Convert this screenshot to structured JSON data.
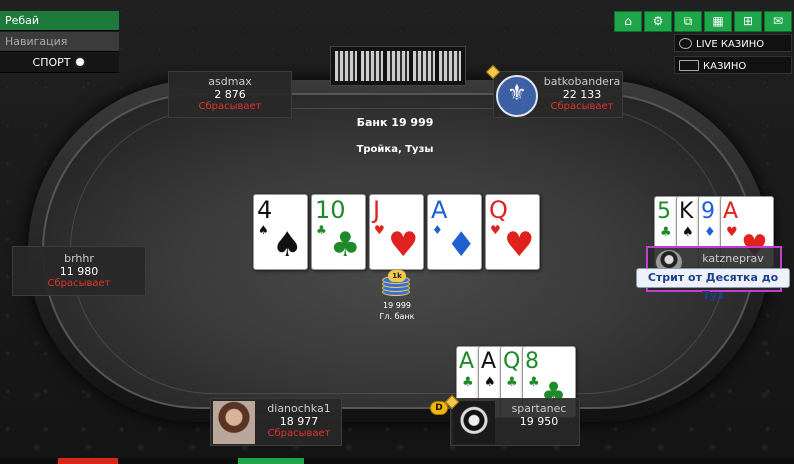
{
  "left_menu": {
    "rebuy": "Ребай",
    "navigation": "Навигация",
    "sport": "СПОРТ"
  },
  "toolbar_icons": [
    "home-icon",
    "gear-icon",
    "tables-icon",
    "grid-icon",
    "add-table-icon",
    "chat-icon"
  ],
  "right_links": {
    "live_casino": "LIVE КАЗИНО",
    "casino": "КАЗИНО"
  },
  "pot": {
    "label": "Банк 19 999",
    "hand": "Тройка, Тузы",
    "main_amount": "19 999",
    "main_label": "Гл. банк",
    "chip_tag": "1k"
  },
  "seats": {
    "asdmax": {
      "name": "asdmax",
      "stack": "2 876",
      "action": "Сбрасывает"
    },
    "batkobandera": {
      "name": "batkobandera",
      "stack": "22 133",
      "action": "Сбрасывает"
    },
    "brhhr": {
      "name": "brhhr",
      "stack": "11 980",
      "action": "Сбрасывает"
    },
    "dianochka1": {
      "name": "dianochka1",
      "stack": "18 977",
      "action": "Сбрасывает"
    },
    "spartanec": {
      "name": "spartanec",
      "stack": "19 950"
    },
    "katznepray": {
      "name": "katzneprav",
      "hand_label": "Стрит от Десятка до Туз"
    }
  },
  "board": [
    {
      "rank": "4",
      "suit": "♠",
      "color": "black"
    },
    {
      "rank": "10",
      "suit": "♣",
      "color": "green"
    },
    {
      "rank": "J",
      "suit": "♥",
      "color": "red"
    },
    {
      "rank": "A",
      "suit": "♦",
      "color": "blue"
    },
    {
      "rank": "Q",
      "suit": "♥",
      "color": "red"
    }
  ],
  "katz_cards": [
    {
      "rank": "5",
      "suit": "♣",
      "color": "green"
    },
    {
      "rank": "K",
      "suit": "♠",
      "color": "black"
    },
    {
      "rank": "9",
      "suit": "♦",
      "color": "blue"
    },
    {
      "rank": "A",
      "suit": "♥",
      "color": "red"
    }
  ],
  "spartanec_cards": [
    {
      "rank": "A",
      "suit": "♣",
      "color": "green"
    },
    {
      "rank": "A",
      "suit": "♠",
      "color": "black"
    },
    {
      "rank": "Q",
      "suit": "♣",
      "color": "green"
    },
    {
      "rank": "8",
      "suit": "♣",
      "color": "green"
    }
  ],
  "dealer_button": "D"
}
